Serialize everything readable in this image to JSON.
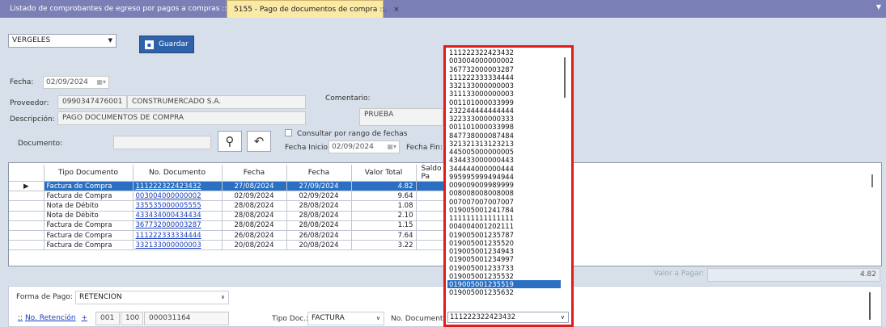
{
  "tabs": [
    {
      "label": "Listado de comprobantes de egreso por pagos a compras ::."
    },
    {
      "label": "5155 - Pago de documentos de compra ::.",
      "close": "×"
    }
  ],
  "header": {
    "store_select": "VERGELES",
    "save_label": "Guardar"
  },
  "form": {
    "fecha_label": "Fecha:",
    "fecha_value": "02/09/2024",
    "proveedor_label": "Proveedor:",
    "proveedor_ruc": "0990347476001",
    "proveedor_name": "CONSTRUMERCADO S.A.",
    "comentario_label": "Comentario:",
    "comentario_value": "PRUEBA",
    "descripcion_label": "Descripción:",
    "descripcion_value": "PAGO DOCUMENTOS DE COMPRA",
    "documento_label": "Documento:",
    "documento_value": "",
    "rango_label": "Consultar por rango de fechas",
    "fecha_inicio_label": "Fecha Inicio:",
    "fecha_inicio_value": "02/09/2024",
    "fecha_fin_label": "Fecha Fin:"
  },
  "grid": {
    "columns": [
      "Tipo Documento",
      "No. Documento",
      "Fecha",
      "Fecha",
      "Valor Total",
      "Saldo x Pa"
    ],
    "rows": [
      {
        "tipo": "Factura de Compra",
        "numero": "111222322423432",
        "fecha1": "27/08/2024",
        "fecha2": "27/09/2024",
        "valor": "4.82"
      },
      {
        "tipo": "Factura de Compra",
        "numero": "003004000000002",
        "fecha1": "02/09/2024",
        "fecha2": "02/09/2024",
        "valor": "9.64"
      },
      {
        "tipo": "Nota de Débito",
        "numero": "335535000005555",
        "fecha1": "28/08/2024",
        "fecha2": "28/08/2024",
        "valor": "1.08"
      },
      {
        "tipo": "Nota de Débito",
        "numero": "433434000434434",
        "fecha1": "28/08/2024",
        "fecha2": "28/08/2024",
        "valor": "2.10"
      },
      {
        "tipo": "Factura de Compra",
        "numero": "367732000003287",
        "fecha1": "28/08/2024",
        "fecha2": "28/08/2024",
        "valor": "1.15"
      },
      {
        "tipo": "Factura de Compra",
        "numero": "111222333334444",
        "fecha1": "26/08/2024",
        "fecha2": "26/08/2024",
        "valor": "7.64"
      },
      {
        "tipo": "Factura de Compra",
        "numero": "332133000000003",
        "fecha1": "20/08/2024",
        "fecha2": "20/08/2024",
        "valor": "3.22"
      }
    ]
  },
  "totals": {
    "valor_pagar_label": "Valor a Pagar:",
    "valor_pagar_value": "4.82"
  },
  "payment": {
    "forma_label": "Forma de Pago:",
    "forma_value": "RETENCION",
    "retencion_link": "No. Retención",
    "plus": "+",
    "ret_serie1": "001",
    "ret_serie2": "100",
    "ret_numero": "000031164",
    "tipo_doc_label": "Tipo Doc.:",
    "tipo_doc_value": "FACTURA",
    "no_documento_label": "No. Documento:",
    "no_documento_value": "111222322423432"
  },
  "dropdown": {
    "items": [
      "111222322423432",
      "003004000000002",
      "367732000003287",
      "111222333334444",
      "332133000000003",
      "311133000000003",
      "001101000033999",
      "232244444444444",
      "322333000000333",
      "001101000033998",
      "847738000087484",
      "321321313123213",
      "445005000000005",
      "434433000000443",
      "344444000000444",
      "995995999494944",
      "009009009989999",
      "008008008008008",
      "007007007007007",
      "019005001241784",
      "111111111111111",
      "004004001202111",
      "019005001235787",
      "019005001235520",
      "019005001234943",
      "019005001234997",
      "019005001233733",
      "019005001235532",
      "019005001235519",
      "019005001235632"
    ],
    "selected_index": 28
  }
}
